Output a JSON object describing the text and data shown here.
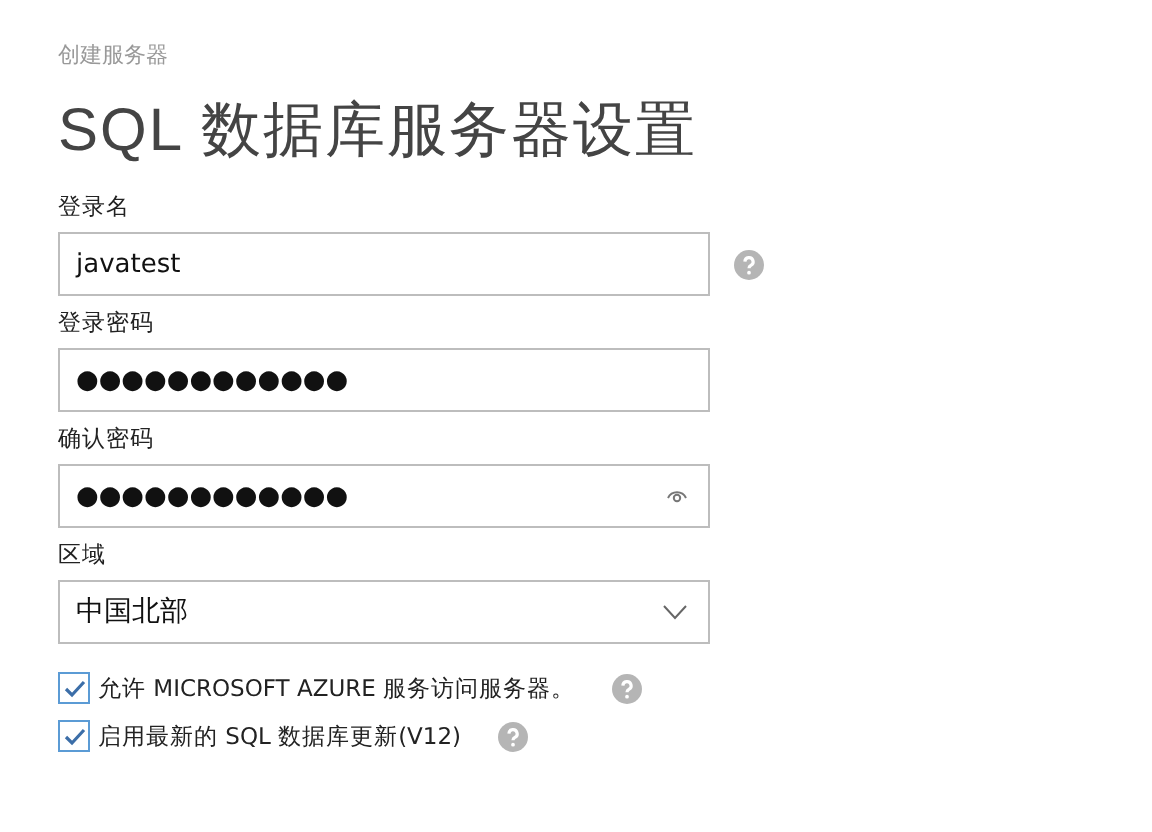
{
  "breadcrumb": "创建服务器",
  "title": "SQL 数据库服务器设置",
  "fields": [
    {
      "kind": "text",
      "label": "登录名",
      "value": "javatest",
      "help": true,
      "reveal": false
    },
    {
      "kind": "text",
      "label": "登录密码",
      "value": "●●●●●●●●●●●●",
      "help": false,
      "reveal": false
    },
    {
      "kind": "text",
      "label": "确认密码",
      "value": "●●●●●●●●●●●●",
      "help": false,
      "reveal": true
    },
    {
      "kind": "select",
      "label": "区域",
      "value": "中国北部",
      "help": false,
      "reveal": false
    }
  ],
  "checkboxes": [
    {
      "label": "允许 MICROSOFT AZURE 服务访问服务器。",
      "checked": true
    },
    {
      "label": "启用最新的 SQL 数据库更新(V12)",
      "checked": true
    }
  ]
}
